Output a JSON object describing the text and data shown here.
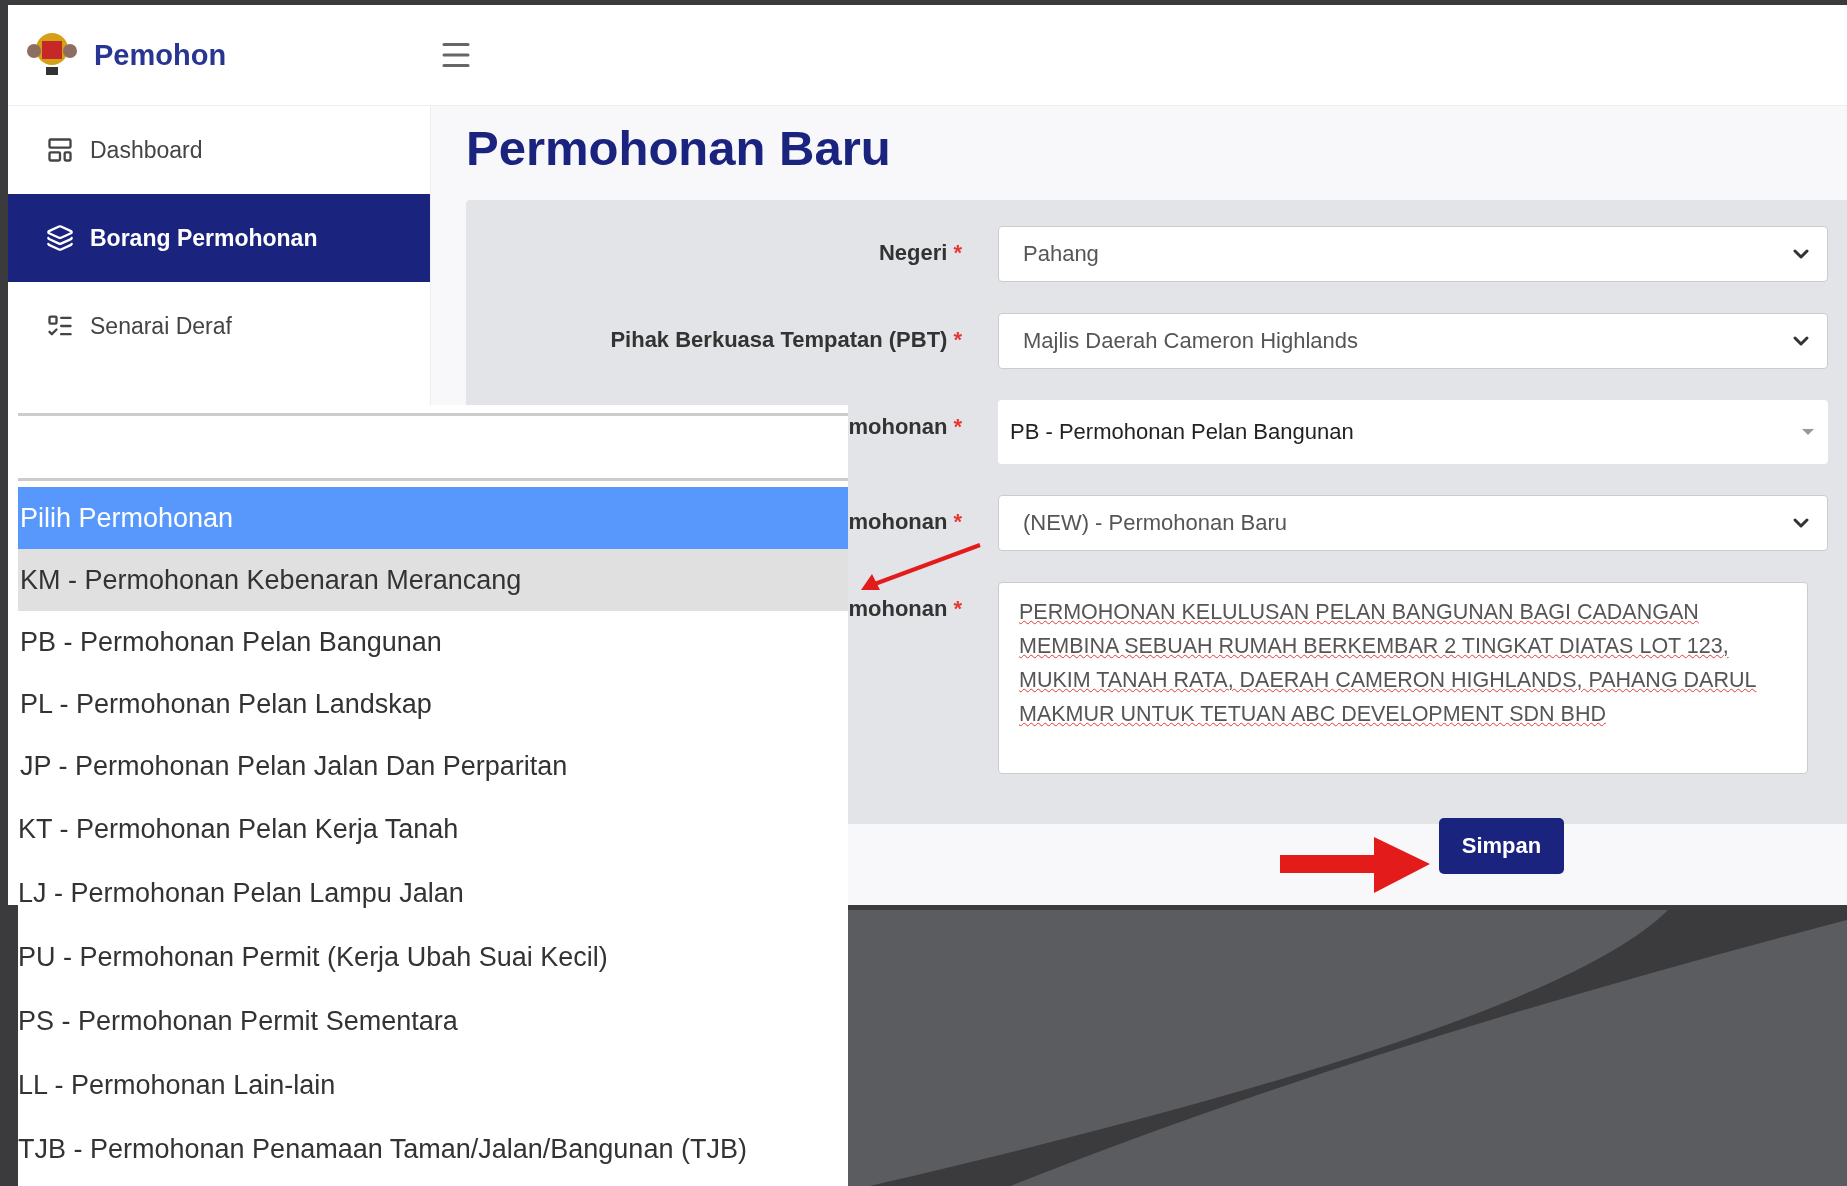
{
  "header": {
    "title": "Pemohon"
  },
  "sidebar": {
    "items": [
      {
        "label": "Dashboard",
        "selected": false
      },
      {
        "label": "Borang Permohonan",
        "selected": true
      },
      {
        "label": "Senarai Deraf",
        "selected": false
      }
    ]
  },
  "page_title": "Permohonan Baru",
  "form": {
    "fields": [
      {
        "label": "Negeri",
        "required": true,
        "kind": "select",
        "value": "Pahang"
      },
      {
        "label": "Pihak Berkuasa Tempatan (PBT)",
        "required": true,
        "kind": "select",
        "value": "Majlis Daerah Cameron Highlands"
      },
      {
        "label": "mohonan",
        "required": true,
        "kind": "combo",
        "value": "PB - Permohonan Pelan Bangunan"
      },
      {
        "label": "mohonan",
        "required": true,
        "kind": "select",
        "value": "(NEW) - Permohonan Baru"
      },
      {
        "label": "mohonan",
        "required": true,
        "kind": "textarea",
        "value": "PERMOHONAN KELULUSAN PELAN BANGUNAN BAGI CADANGAN MEMBINA SEBUAH RUMAH BERKEMBAR 2 TINGKAT DIATAS LOT 123, MUKIM TANAH RATA, DAERAH CAMERON HIGHLANDS, PAHANG DARUL MAKMUR UNTUK TETUAN ABC DEVELOPMENT SDN BHD"
      }
    ],
    "required_mark": "*",
    "save_button": "Simpan"
  },
  "dropdown": {
    "options": [
      {
        "label": "Pilih Permohonan",
        "selected": true,
        "hovered": false
      },
      {
        "label": "KM - Permohonan Kebenaran Merancang",
        "selected": false,
        "hovered": true
      },
      {
        "label": "PB - Permohonan Pelan Bangunan",
        "selected": false,
        "hovered": false
      },
      {
        "label": "PL - Permohonan Pelan Landskap",
        "selected": false,
        "hovered": false
      },
      {
        "label": "JP - Permohonan Pelan Jalan Dan Perparitan",
        "selected": false,
        "hovered": false
      },
      {
        "label": "KT - Permohonan Pelan Kerja Tanah",
        "selected": false,
        "hovered": false
      },
      {
        "label": "LJ - Permohonan Pelan Lampu Jalan",
        "selected": false,
        "hovered": false
      },
      {
        "label": "PU - Permohonan Permit (Kerja Ubah Suai Kecil)",
        "selected": false,
        "hovered": false
      },
      {
        "label": "PS - Permohonan Permit Sementara",
        "selected": false,
        "hovered": false
      },
      {
        "label": "LL - Permohonan Lain-lain",
        "selected": false,
        "hovered": false
      },
      {
        "label": "TJB - Permohonan Penamaan Taman/Jalan/Bangunan (TJB)",
        "selected": false,
        "hovered": false
      }
    ]
  }
}
